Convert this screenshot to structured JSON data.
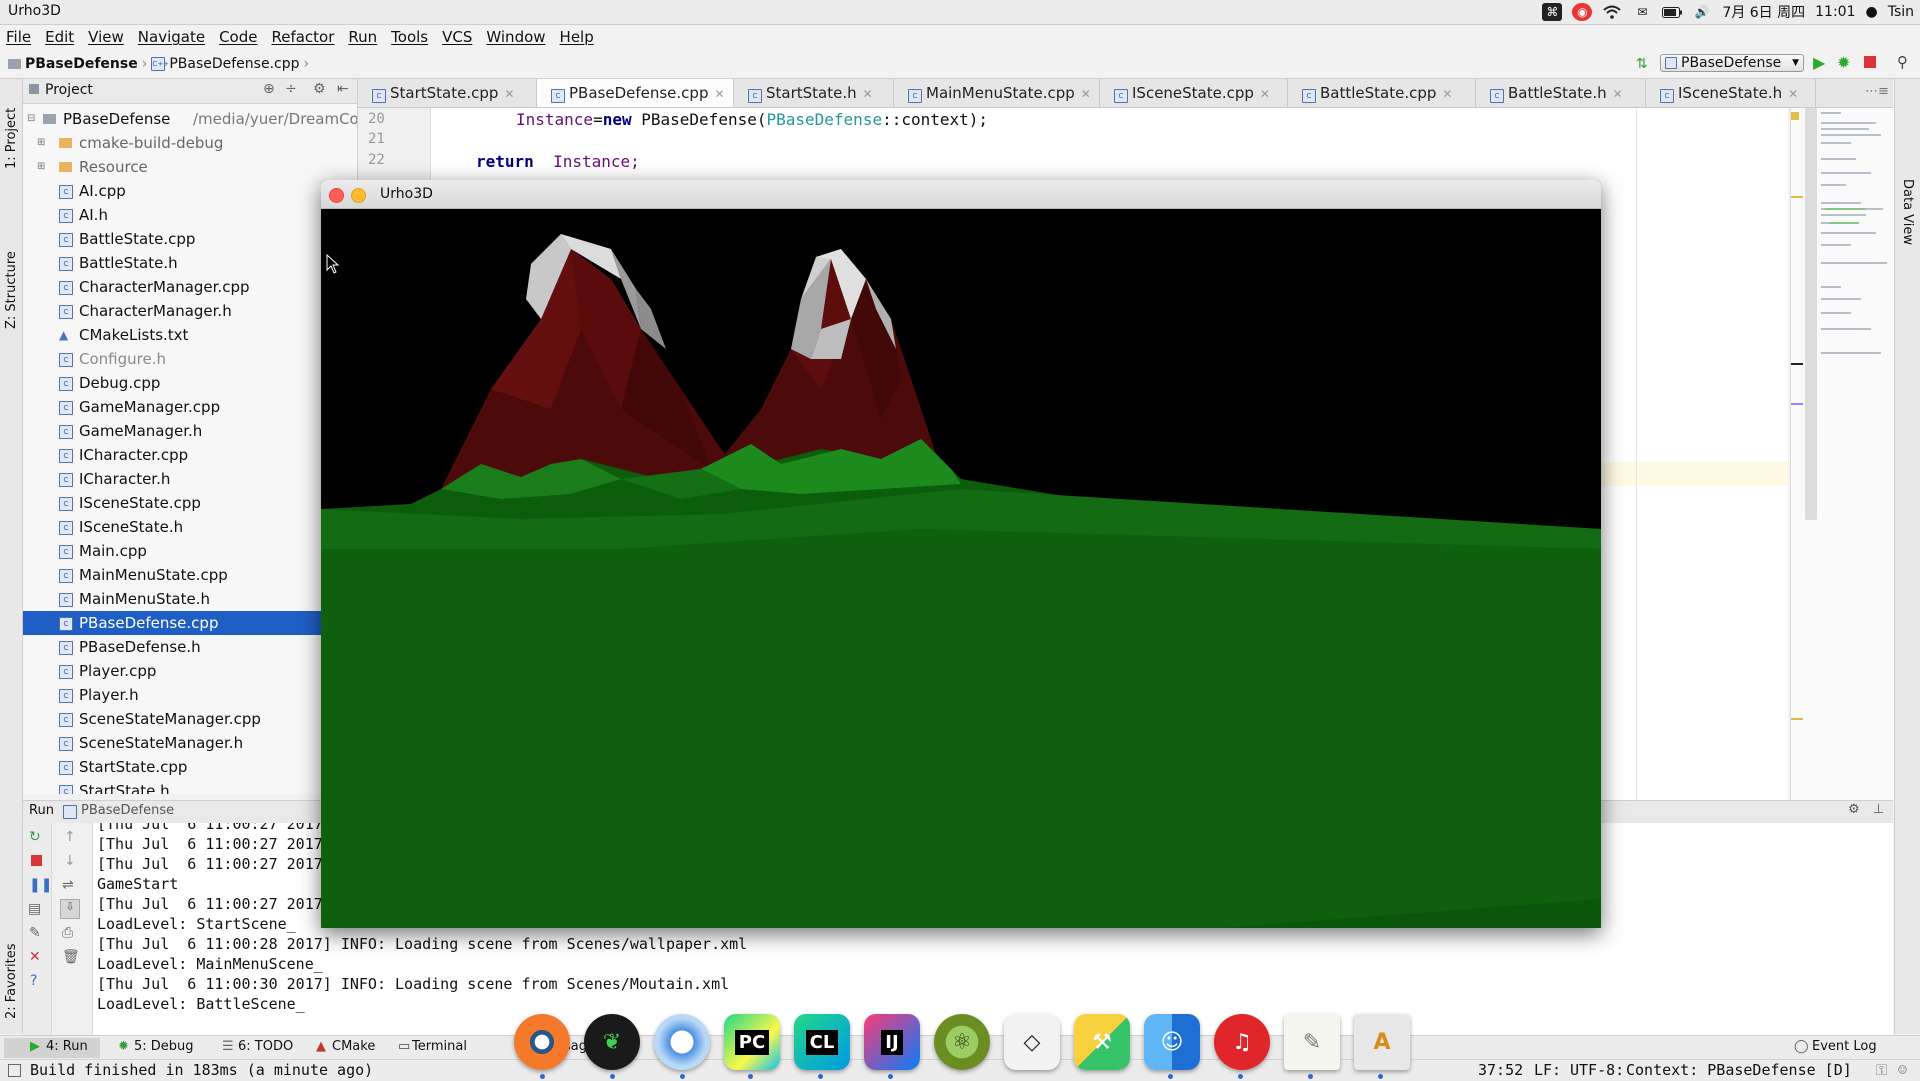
{
  "system_bar": {
    "app_title": "Urho3D",
    "date": "7月 6日 周四",
    "time": "11:01",
    "user": "Tsin"
  },
  "menu": [
    "File",
    "Edit",
    "View",
    "Navigate",
    "Code",
    "Refactor",
    "Run",
    "Tools",
    "VCS",
    "Window",
    "Help"
  ],
  "nav": {
    "project": "PBaseDefense",
    "file": "PBaseDefense.cpp",
    "run_config": "PBaseDefense"
  },
  "project_panel": {
    "title": "Project",
    "root": "PBaseDefense",
    "root_path": "/media/yuer/DreamCo",
    "folders": [
      "cmake-build-debug",
      "Resource"
    ],
    "files": [
      "AI.cpp",
      "AI.h",
      "BattleState.cpp",
      "BattleState.h",
      "CharacterManager.cpp",
      "CharacterManager.h",
      "CMakeLists.txt",
      "Configure.h",
      "Debug.cpp",
      "GameManager.cpp",
      "GameManager.h",
      "ICharacter.cpp",
      "ICharacter.h",
      "ISceneState.cpp",
      "ISceneState.h",
      "Main.cpp",
      "MainMenuState.cpp",
      "MainMenuState.h",
      "PBaseDefense.cpp",
      "PBaseDefense.h",
      "Player.cpp",
      "Player.h",
      "SceneStateManager.cpp",
      "SceneStateManager.h",
      "StartState.cpp",
      "StartState.h"
    ],
    "selected": "PBaseDefense.cpp"
  },
  "tabs": [
    {
      "label": "StartState.cpp"
    },
    {
      "label": "PBaseDefense.cpp",
      "active": true
    },
    {
      "label": "StartState.h"
    },
    {
      "label": "MainMenuState.cpp"
    },
    {
      "label": "ISceneState.cpp"
    },
    {
      "label": "BattleState.cpp"
    },
    {
      "label": "BattleState.h"
    },
    {
      "label": "ISceneState.h"
    }
  ],
  "editor": {
    "line_numbers": [
      "20",
      "21",
      "22"
    ],
    "line20": {
      "var": "Instance",
      "op": "=",
      "kw": "new",
      "type": "PBaseDefense(",
      "ns": "PBaseDefense",
      "rest": "::context);"
    },
    "line22": {
      "kw": "return",
      "var": "Instance;"
    }
  },
  "game_window": {
    "title": "Urho3D"
  },
  "run_panel": {
    "label": "Run",
    "config": "PBaseDefense",
    "lines": [
      "[Thu Jul  6 11:00:27 2017",
      "[Thu Jul  6 11:00:27 2017",
      "[Thu Jul  6 11:00:27 2017",
      "GameStart",
      "[Thu Jul  6 11:00:27 2017",
      "LoadLevel: StartScene_",
      "[Thu Jul  6 11:00:28 2017] INFO: Loading scene from Scenes/wallpaper.xml",
      "LoadLevel: MainMenuScene_",
      "[Thu Jul  6 11:00:30 2017] INFO: Loading scene from Scenes/Moutain.xml",
      "LoadLevel: BattleScene_"
    ]
  },
  "tool_tabs": {
    "run": "4: Run",
    "debug": "5: Debug",
    "todo": "6: TODO",
    "cmake": "CMake",
    "terminal": "Terminal",
    "messages_partial": "sag",
    "event_log": "Event Log"
  },
  "left_strip": {
    "project": "1: Project",
    "structure": "Z: Structure",
    "favorites": "2: Favorites"
  },
  "right_strip": {
    "data_view": "Data View"
  },
  "status": {
    "message": "Build finished in 183ms (a minute ago)",
    "position": "37:52",
    "line_ending": "LF:",
    "encoding": "UTF-8:",
    "context": "Context: PBaseDefense [D]"
  },
  "dock_icons": [
    "blender",
    "qt-creator",
    "chromium",
    "pycharm",
    "clion",
    "intellij",
    "android-studio",
    "unity",
    "sublime-hammer",
    "finder",
    "netease-music",
    "text-editor",
    "app-installer"
  ]
}
